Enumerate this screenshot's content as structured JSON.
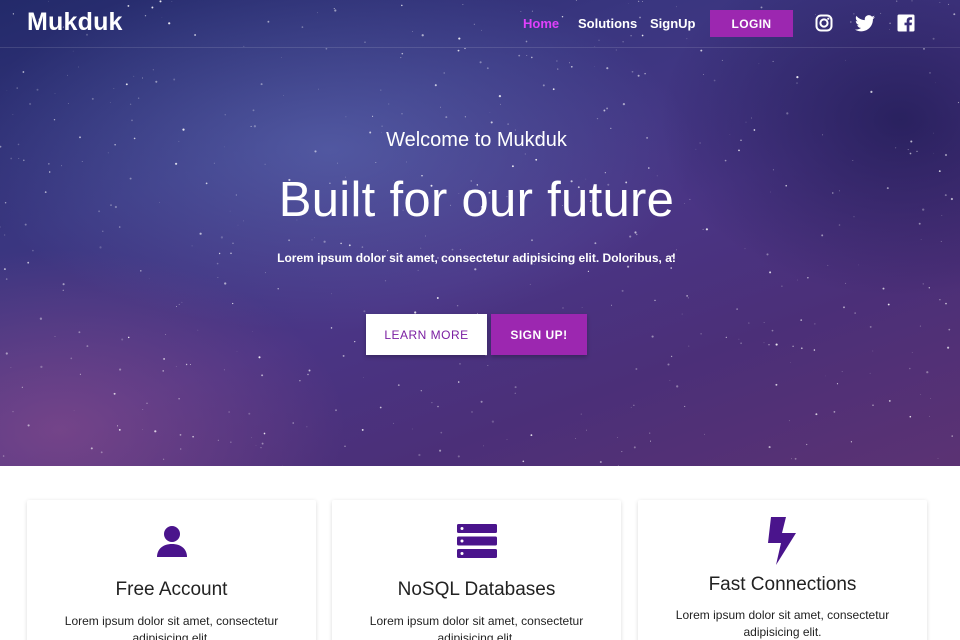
{
  "navbar": {
    "brand": "Mukduk",
    "links": [
      {
        "label": "Home",
        "active": true
      },
      {
        "label": "Solutions",
        "active": false
      },
      {
        "label": "SignUp",
        "active": false
      }
    ],
    "login_label": "LOGIN",
    "social_icons": [
      "instagram-icon",
      "twitter-icon",
      "facebook-icon"
    ]
  },
  "hero": {
    "welcome": "Welcome to Mukduk",
    "headline": "Built for our future",
    "subtext": "Lorem ipsum dolor sit amet, consectetur adipisicing elit. Doloribus, a!",
    "learn_more_label": "LEARN MORE",
    "signup_label": "SIGN UP!"
  },
  "features": [
    {
      "icon": "user-icon",
      "title": "Free Account",
      "text": "Lorem ipsum dolor sit amet, consectetur adipisicing elit."
    },
    {
      "icon": "database-icon",
      "title": "NoSQL Databases",
      "text": "Lorem ipsum dolor sit amet, consectetur adipisicing elit."
    },
    {
      "icon": "bolt-icon",
      "title": "Fast Connections",
      "text": "Lorem ipsum dolor sit amet, consectetur adipisicing elit."
    }
  ],
  "colors": {
    "accent": "#9c27b0",
    "active_link": "#e040fb",
    "icon_purple": "#4a148c"
  }
}
